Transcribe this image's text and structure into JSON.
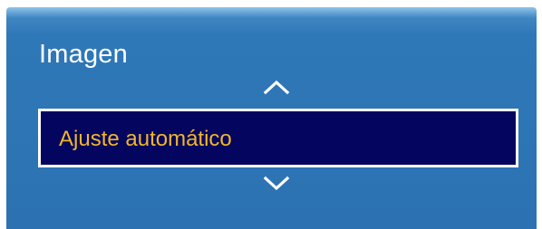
{
  "menu": {
    "title": "Imagen",
    "selected_item": {
      "label": "Ajuste automático"
    },
    "up_icon": "chevron-up-icon",
    "down_icon": "chevron-down-icon"
  },
  "colors": {
    "panel_top": "#8ec4e8",
    "panel": "#2f78b8",
    "selection_background": "#03055f",
    "selection_border": "#ffffff",
    "selection_text": "#f1b62a",
    "title_text": "#ffffff"
  }
}
